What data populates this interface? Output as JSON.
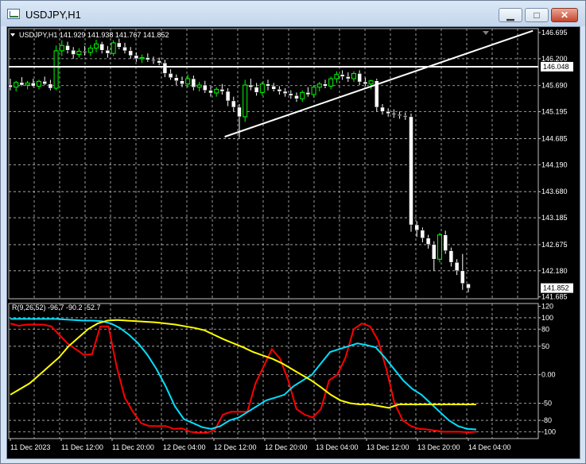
{
  "window": {
    "title": "USDJPY,H1",
    "minimize_label": "▁",
    "maximize_label": "□",
    "close_label": "✕"
  },
  "chart_data": [
    {
      "type": "candlestick",
      "symbol": "USDJPY",
      "timeframe": "H1",
      "header": "USDJPY,H1  141.929 141.938 141.767 141.852",
      "ohlc_last": {
        "open": 141.929,
        "high": 141.938,
        "low": 141.767,
        "close": 141.852
      },
      "y_ticks": [
        "146.695",
        "146.200",
        "145.690",
        "145.195",
        "144.685",
        "144.190",
        "143.680",
        "143.185",
        "142.675",
        "142.180",
        "141.685"
      ],
      "ylim": [
        141.65,
        146.77
      ],
      "price_label": "141.852",
      "hline_label": "146.048",
      "hline_value": 146.048,
      "trendline": [
        {
          "x": 38,
          "y": 144.72
        },
        {
          "x": 101,
          "y": 146.73
        }
      ],
      "grid": true,
      "colors": {
        "up": "#00ff00",
        "down": "#ffffff",
        "background": "#000000",
        "grid": "#c0c0c0"
      },
      "candles": [
        [
          145.7,
          145.82,
          145.6,
          145.66
        ],
        [
          145.66,
          145.78,
          145.58,
          145.75
        ],
        [
          145.75,
          145.85,
          145.68,
          145.7
        ],
        [
          145.7,
          145.78,
          145.62,
          145.74
        ],
        [
          145.74,
          145.82,
          145.66,
          145.68
        ],
        [
          145.68,
          145.8,
          145.62,
          145.77
        ],
        [
          145.77,
          145.86,
          145.7,
          145.72
        ],
        [
          145.72,
          145.8,
          145.6,
          145.64
        ],
        [
          145.64,
          146.45,
          145.6,
          146.35
        ],
        [
          146.35,
          146.55,
          146.25,
          146.45
        ],
        [
          146.45,
          146.52,
          146.3,
          146.36
        ],
        [
          146.36,
          146.42,
          146.2,
          146.28
        ],
        [
          146.28,
          146.4,
          146.22,
          146.34
        ],
        [
          146.34,
          146.44,
          146.26,
          146.32
        ],
        [
          146.32,
          146.46,
          146.25,
          146.4
        ],
        [
          146.4,
          146.56,
          146.32,
          146.48
        ],
        [
          146.48,
          146.52,
          146.3,
          146.36
        ],
        [
          146.36,
          146.44,
          146.22,
          146.3
        ],
        [
          146.3,
          146.55,
          146.25,
          146.5
        ],
        [
          146.5,
          146.58,
          146.38,
          146.42
        ],
        [
          146.42,
          146.5,
          146.3,
          146.35
        ],
        [
          146.35,
          146.42,
          146.2,
          146.26
        ],
        [
          146.26,
          146.32,
          146.14,
          146.2
        ],
        [
          146.2,
          146.28,
          146.12,
          146.22
        ],
        [
          146.22,
          146.3,
          146.14,
          146.18
        ],
        [
          146.18,
          146.24,
          146.1,
          146.16
        ],
        [
          146.16,
          146.22,
          146.08,
          146.12
        ],
        [
          146.12,
          146.18,
          145.85,
          145.92
        ],
        [
          145.92,
          146.0,
          145.8,
          145.84
        ],
        [
          145.84,
          145.9,
          145.7,
          145.78
        ],
        [
          145.78,
          145.86,
          145.66,
          145.72
        ],
        [
          145.72,
          145.9,
          145.66,
          145.82
        ],
        [
          145.82,
          145.88,
          145.6,
          145.66
        ],
        [
          145.66,
          145.76,
          145.58,
          145.7
        ],
        [
          145.7,
          145.78,
          145.55,
          145.6
        ],
        [
          145.6,
          145.68,
          145.48,
          145.55
        ],
        [
          145.55,
          145.66,
          145.48,
          145.62
        ],
        [
          145.62,
          145.72,
          145.52,
          145.58
        ],
        [
          145.58,
          145.64,
          145.3,
          145.4
        ],
        [
          145.4,
          145.48,
          145.2,
          145.28
        ],
        [
          145.28,
          145.34,
          144.7,
          145.1
        ],
        [
          145.1,
          145.8,
          145.0,
          145.7
        ],
        [
          145.7,
          145.82,
          145.6,
          145.66
        ],
        [
          145.66,
          145.74,
          145.5,
          145.56
        ],
        [
          145.56,
          145.76,
          145.5,
          145.72
        ],
        [
          145.72,
          145.8,
          145.6,
          145.68
        ],
        [
          145.68,
          145.74,
          145.58,
          145.62
        ],
        [
          145.62,
          145.68,
          145.52,
          145.58
        ],
        [
          145.58,
          145.64,
          145.48,
          145.54
        ],
        [
          145.54,
          145.6,
          145.44,
          145.5
        ],
        [
          145.5,
          145.56,
          145.38,
          145.44
        ],
        [
          145.44,
          145.6,
          145.38,
          145.56
        ],
        [
          145.56,
          145.66,
          145.48,
          145.52
        ],
        [
          145.52,
          145.7,
          145.46,
          145.66
        ],
        [
          145.66,
          145.76,
          145.58,
          145.72
        ],
        [
          145.72,
          145.8,
          145.64,
          145.68
        ],
        [
          145.68,
          145.86,
          145.62,
          145.82
        ],
        [
          145.82,
          145.96,
          145.74,
          145.9
        ],
        [
          145.9,
          145.98,
          145.8,
          145.86
        ],
        [
          145.86,
          145.94,
          145.76,
          145.82
        ],
        [
          145.82,
          145.96,
          145.76,
          145.92
        ],
        [
          145.92,
          145.98,
          145.7,
          145.76
        ],
        [
          145.76,
          145.84,
          145.68,
          145.72
        ],
        [
          145.72,
          145.8,
          145.62,
          145.78
        ],
        [
          145.78,
          145.82,
          145.2,
          145.28
        ],
        [
          145.28,
          145.34,
          145.14,
          145.2
        ],
        [
          145.2,
          145.26,
          145.1,
          145.16
        ],
        [
          145.16,
          145.24,
          145.08,
          145.14
        ],
        [
          145.14,
          145.2,
          145.06,
          145.12
        ],
        [
          145.12,
          145.18,
          145.04,
          145.1
        ],
        [
          145.1,
          145.16,
          142.92,
          143.05
        ],
        [
          143.05,
          143.12,
          142.82,
          142.95
        ],
        [
          142.95,
          143.0,
          142.72,
          142.8
        ],
        [
          142.8,
          142.86,
          142.6,
          142.68
        ],
        [
          142.68,
          142.74,
          142.18,
          142.4
        ],
        [
          142.4,
          142.9,
          142.34,
          142.86
        ],
        [
          142.86,
          142.94,
          142.5,
          142.56
        ],
        [
          142.56,
          142.62,
          142.26,
          142.34
        ],
        [
          142.34,
          142.4,
          142.1,
          142.18
        ],
        [
          142.18,
          142.5,
          141.82,
          141.94
        ],
        [
          141.93,
          141.94,
          141.77,
          141.85
        ]
      ]
    },
    {
      "type": "line",
      "title": "R(9,26,52) -96.7 -90.2 -52.7",
      "values_label": "R(9,26,52)",
      "last_values": [
        "-96.7",
        "-90.2",
        "-52.7"
      ],
      "y_ticks": [
        "120",
        "100",
        "80",
        "50",
        "0.00",
        "-50",
        "-80",
        "-100"
      ],
      "ylim": [
        -112,
        125
      ],
      "x_ticks": [
        "11 Dec 2023",
        "11 Dec 12:00",
        "11 Dec 20:00",
        "12 Dec 04:00",
        "12 Dec 12:00",
        "12 Dec 20:00",
        "13 Dec 04:00",
        "13 Dec 12:00",
        "13 Dec 20:00",
        "14 Dec 04:00"
      ],
      "series": [
        {
          "color": "#ff0000",
          "values": [
            90,
            86,
            88,
            88,
            88,
            85,
            70,
            55,
            45,
            35,
            36,
            85,
            85,
            15,
            -40,
            -65,
            -85,
            -90,
            -90,
            -90,
            -95,
            -94,
            -100,
            -102,
            -102,
            -97,
            -70,
            -65,
            -65,
            -65,
            -15,
            15,
            45,
            28,
            -10,
            -60,
            -70,
            -75,
            -60,
            -10,
            0,
            30,
            80,
            90,
            85,
            60,
            10,
            -50,
            -80,
            -90,
            -95,
            -96,
            -98,
            -100,
            -100,
            -100,
            -101,
            -100
          ]
        },
        {
          "color": "#00e0ff",
          "values": [
            98,
            98,
            98,
            98,
            98,
            98,
            97,
            96,
            95,
            95,
            94,
            90,
            82,
            70,
            55,
            35,
            10,
            -20,
            -55,
            -78,
            -85,
            -92,
            -95,
            -90,
            -80,
            -75,
            -65,
            -55,
            -45,
            -40,
            -35,
            -20,
            -10,
            0,
            20,
            40,
            45,
            50,
            55,
            52,
            48,
            30,
            10,
            -10,
            -25,
            -35,
            -50,
            -65,
            -80,
            -90,
            -95,
            -96
          ]
        },
        {
          "color": "#ffff00",
          "values": [
            -35,
            -25,
            -15,
            0,
            15,
            30,
            50,
            65,
            80,
            90,
            95,
            96,
            95,
            94,
            93,
            92,
            90,
            88,
            85,
            82,
            78,
            70,
            62,
            55,
            48,
            40,
            34,
            28,
            20,
            10,
            0,
            -10,
            -22,
            -35,
            -45,
            -50,
            -52,
            -52,
            -55,
            -58,
            -52,
            -52,
            -52,
            -52,
            -52,
            -52,
            -52,
            -52,
            -52
          ]
        }
      ]
    }
  ]
}
